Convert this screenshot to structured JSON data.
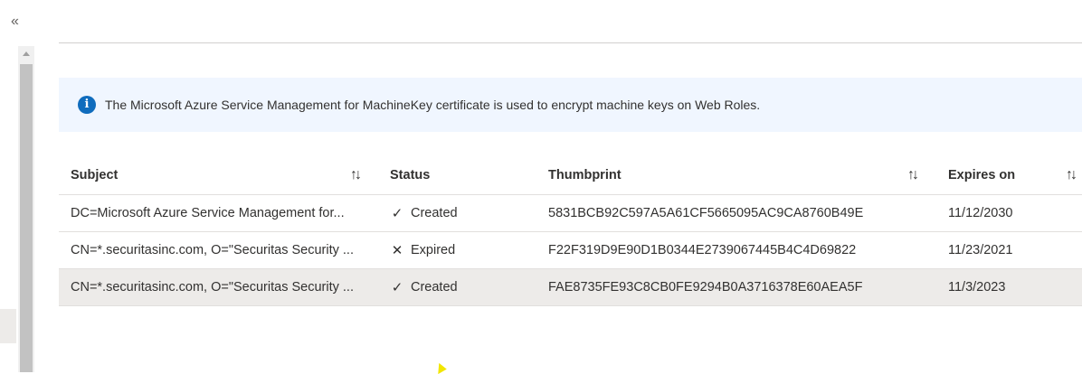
{
  "nav": {
    "collapse_glyph": "«"
  },
  "info_bar": {
    "icon": "info-icon",
    "icon_glyph": "i",
    "message": "The Microsoft Azure Service Management for MachineKey certificate is used to encrypt machine keys on Web Roles."
  },
  "table": {
    "columns": [
      {
        "label": "Subject",
        "sortable": true
      },
      {
        "label": "Status",
        "sortable": false
      },
      {
        "label": "Thumbprint",
        "sortable": true
      },
      {
        "label": "Expires on",
        "sortable": true
      }
    ],
    "sort_glyph": "↑↓",
    "rows": [
      {
        "subject": "DC=Microsoft Azure Service Management for...",
        "status_icon": "check-icon",
        "status_glyph": "✓",
        "status": "Created",
        "thumbprint": "5831BCB92C597A5A61CF5665095AC9CA8760B49E",
        "expires": "11/12/2030",
        "selected": false
      },
      {
        "subject": "CN=*.securitasinc.com, O=\"Securitas Security ...",
        "status_icon": "x-icon",
        "status_glyph": "✕",
        "status": "Expired",
        "thumbprint": "F22F319D9E90D1B0344E2739067445B4C4D69822",
        "expires": "11/23/2021",
        "selected": false
      },
      {
        "subject": "CN=*.securitasinc.com, O=\"Securitas Security ...",
        "status_icon": "check-icon",
        "status_glyph": "✓",
        "status": "Created",
        "thumbprint": "FAE8735FE93C8CB0FE9294B0A3716378E60AEA5F",
        "expires": "11/3/2023",
        "selected": true
      }
    ]
  },
  "colors": {
    "info_background": "#f0f6ff",
    "info_icon": "#0f6cbd",
    "selected_row": "#edebe9"
  }
}
